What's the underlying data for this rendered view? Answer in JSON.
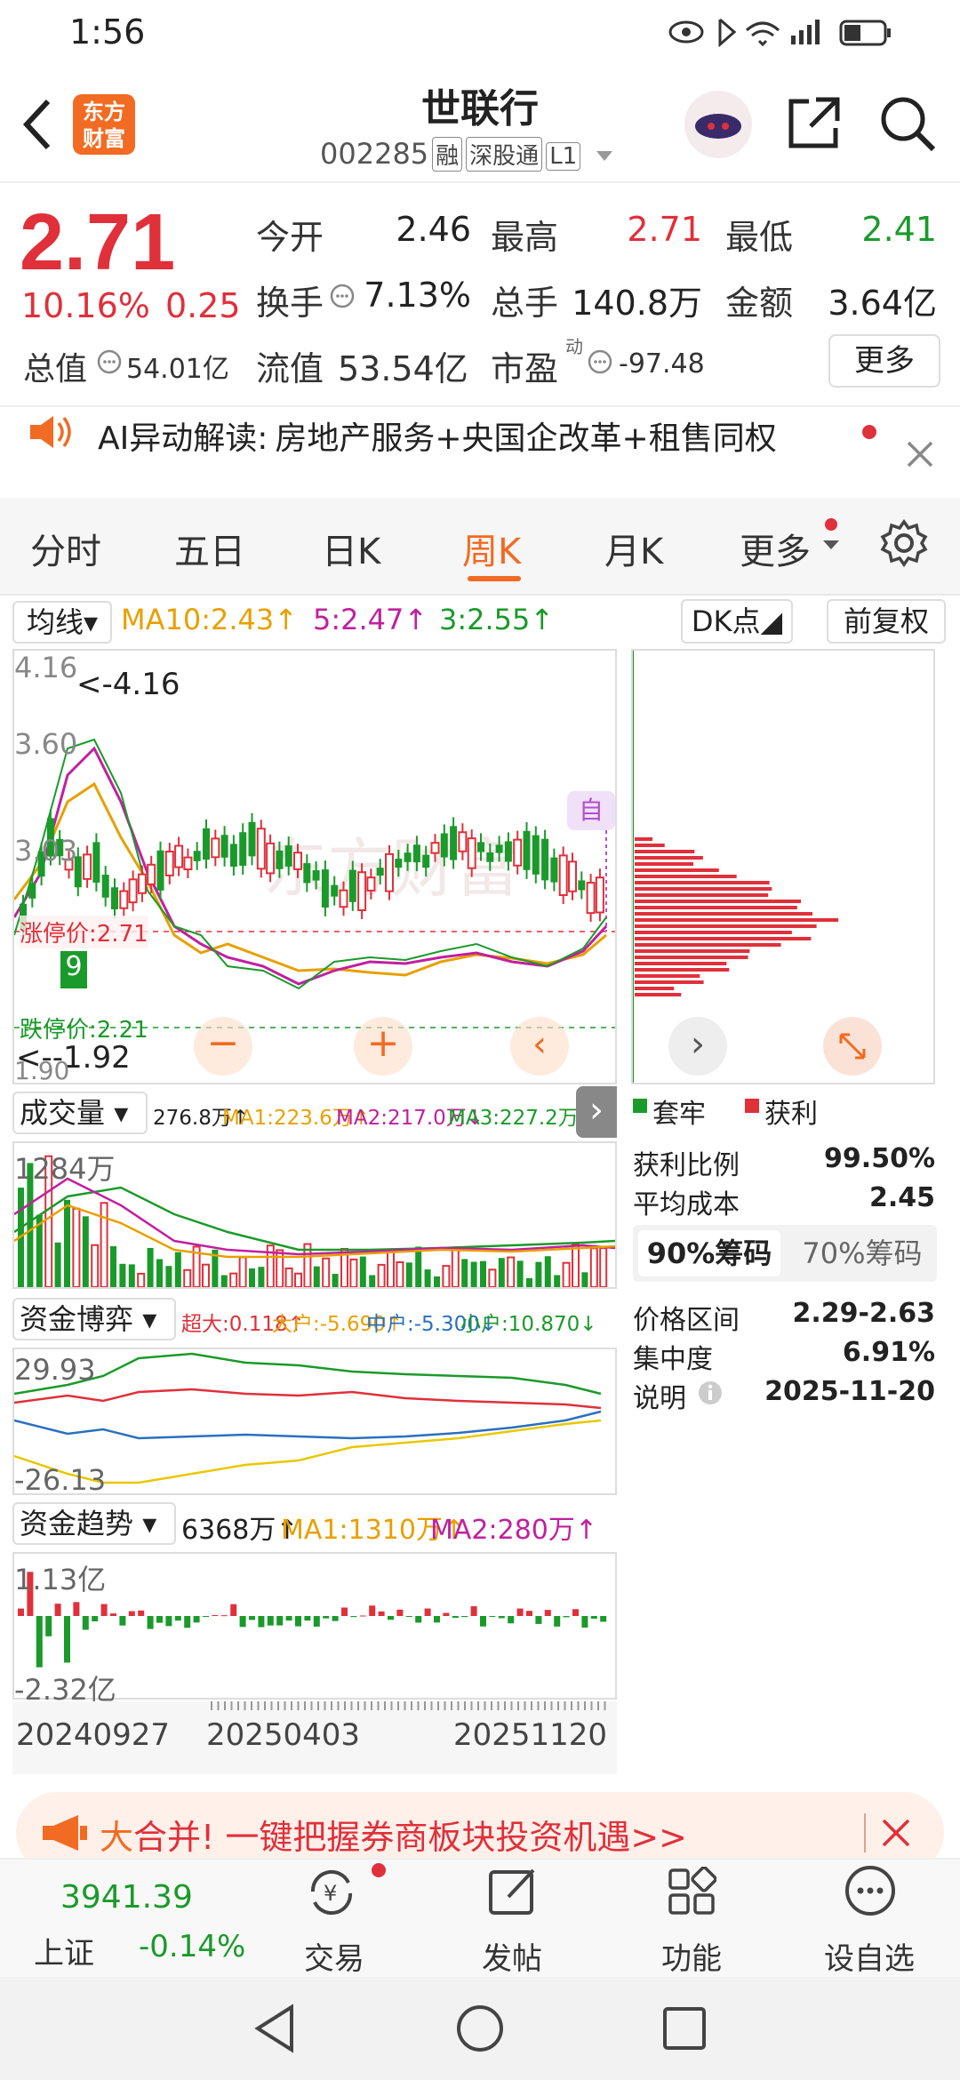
{
  "status": {
    "time": "1:56"
  },
  "header": {
    "logo_line1": "东方",
    "logo_line2": "财富",
    "title": "世联行",
    "code": "002285",
    "tags": [
      "融",
      "深股通",
      "L1"
    ]
  },
  "quote": {
    "price": "2.71",
    "pct": "10.16%",
    "chg": "0.25",
    "open_label": "今开",
    "open": "2.46",
    "high_label": "最高",
    "high": "2.71",
    "low_label": "最低",
    "low": "2.41",
    "turnover_label": "换手",
    "turnover": "7.13%",
    "vol_label": "总手",
    "vol": "140.8万",
    "amount_label": "金额",
    "amount": "3.64亿",
    "mcap_label": "总值",
    "mcap": "54.01亿",
    "float_label": "流值",
    "float": "53.54亿",
    "pe_label": "市盈",
    "pe_sup": "动",
    "pe": "-97.48",
    "more": "更多"
  },
  "ai": {
    "label": "AI异动解读:",
    "text": "房地产服务+央国企改革+租售同权"
  },
  "tabs": [
    "分时",
    "五日",
    "日K",
    "周K",
    "月K",
    "更多"
  ],
  "active_tab": "周K",
  "chart_toolbar": {
    "ma_select": "均线",
    "ma10": "MA10:2.43↑",
    "ma5": "5:2.47↑",
    "ma3": "3:2.55↑",
    "dk": "DK点",
    "adj": "前复权"
  },
  "kline": {
    "y_top": "4.16",
    "y2": "3.60",
    "y3": "3.03",
    "y_bottom": "1.90",
    "max_label": "<-4.16",
    "min_label": "<--1.92",
    "limit_up": "涨停价:2.71",
    "limit_down": "跌停价:2.21",
    "watermark": "东方财富",
    "self_tag": "自",
    "badge": "9"
  },
  "volume": {
    "title": "成交量",
    "value": "276.8万↑",
    "ma1": "MA1:223.6万↑",
    "ma2": "MA2:217.0万↓",
    "ma3": "MA3:227.2万↑",
    "y_top": "1284万"
  },
  "fund": {
    "title": "资金博弈",
    "big": "超大:0.118↑",
    "large": "大户:-5.690↑",
    "mid": "中户:-5.300↓",
    "small": "小户:10.870↓",
    "y_top": "29.93",
    "y_bottom": "-26.13"
  },
  "trend": {
    "title": "资金趋势",
    "value": "6368万↑",
    "ma1": "MA1:1310万↑",
    "ma2": "MA2:280万↑",
    "y_top": "1.13亿",
    "y_bottom": "-2.32亿"
  },
  "dates": [
    "20240927",
    "20250403",
    "20251120"
  ],
  "chip": {
    "legend_trap": "套牢",
    "legend_profit": "获利",
    "profit_ratio_label": "获利比例",
    "profit_ratio": "99.50%",
    "avg_cost_label": "平均成本",
    "avg_cost": "2.45",
    "tab90": "90%筹码",
    "tab70": "70%筹码",
    "range_label": "价格区间",
    "range": "2.29-2.63",
    "conc_label": "集中度",
    "conc": "6.91%",
    "note_label": "说明",
    "note_date": "2025-11-20"
  },
  "ad": {
    "text_hl": "大",
    "text": "合并! 一键把握券商板块投资机遇>>"
  },
  "bottom": {
    "index_value": "3941.39",
    "index_name": "上证",
    "index_pct": "-0.14%",
    "trade": "交易",
    "post": "发帖",
    "func": "功能",
    "watch": "设自选"
  }
}
